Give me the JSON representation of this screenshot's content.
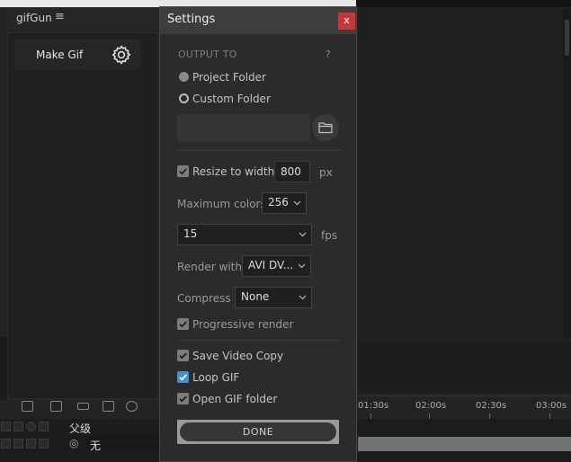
{
  "host_panel": {
    "title": "gifGun",
    "menu_icon": "hamburger-icon",
    "make_gif_label": "Make Gif",
    "settings_icon": "gear-icon"
  },
  "timeline": {
    "ticks": [
      "01:30s",
      "02:00s",
      "02:30s",
      "03:00s"
    ],
    "layer_header": "父级",
    "layer_value": "无"
  },
  "dialog": {
    "title": "Settings",
    "close_label": "x",
    "output_to_label": "OUTPUT TO",
    "help_label": "?",
    "project_folder_label": "Project Folder",
    "custom_folder_label": "Custom Folder",
    "folder_path": "",
    "folder_icon": "folder-icon",
    "resize_label": "Resize to width",
    "resize_checked": true,
    "resize_value": "800",
    "resize_unit": "px",
    "max_colors_label": "Maximum colors",
    "max_colors_value": "256",
    "fps_value": "15",
    "fps_unit": "fps",
    "render_with_label": "Render with",
    "render_with_value": "AVI DV...",
    "compress_label": "Compress",
    "compress_value": "None",
    "progressive_label": "Progressive render",
    "progressive_checked": true,
    "save_video_label": "Save Video Copy",
    "save_video_checked": true,
    "loop_gif_label": "Loop GIF",
    "loop_gif_checked": true,
    "open_folder_label": "Open GIF folder",
    "open_folder_checked": true,
    "done_label": "DONE"
  },
  "colors": {
    "close_button": "#c1393a",
    "loop_check_accent": "#3a8fe8",
    "dialog_bg": "#2b2b2b"
  }
}
